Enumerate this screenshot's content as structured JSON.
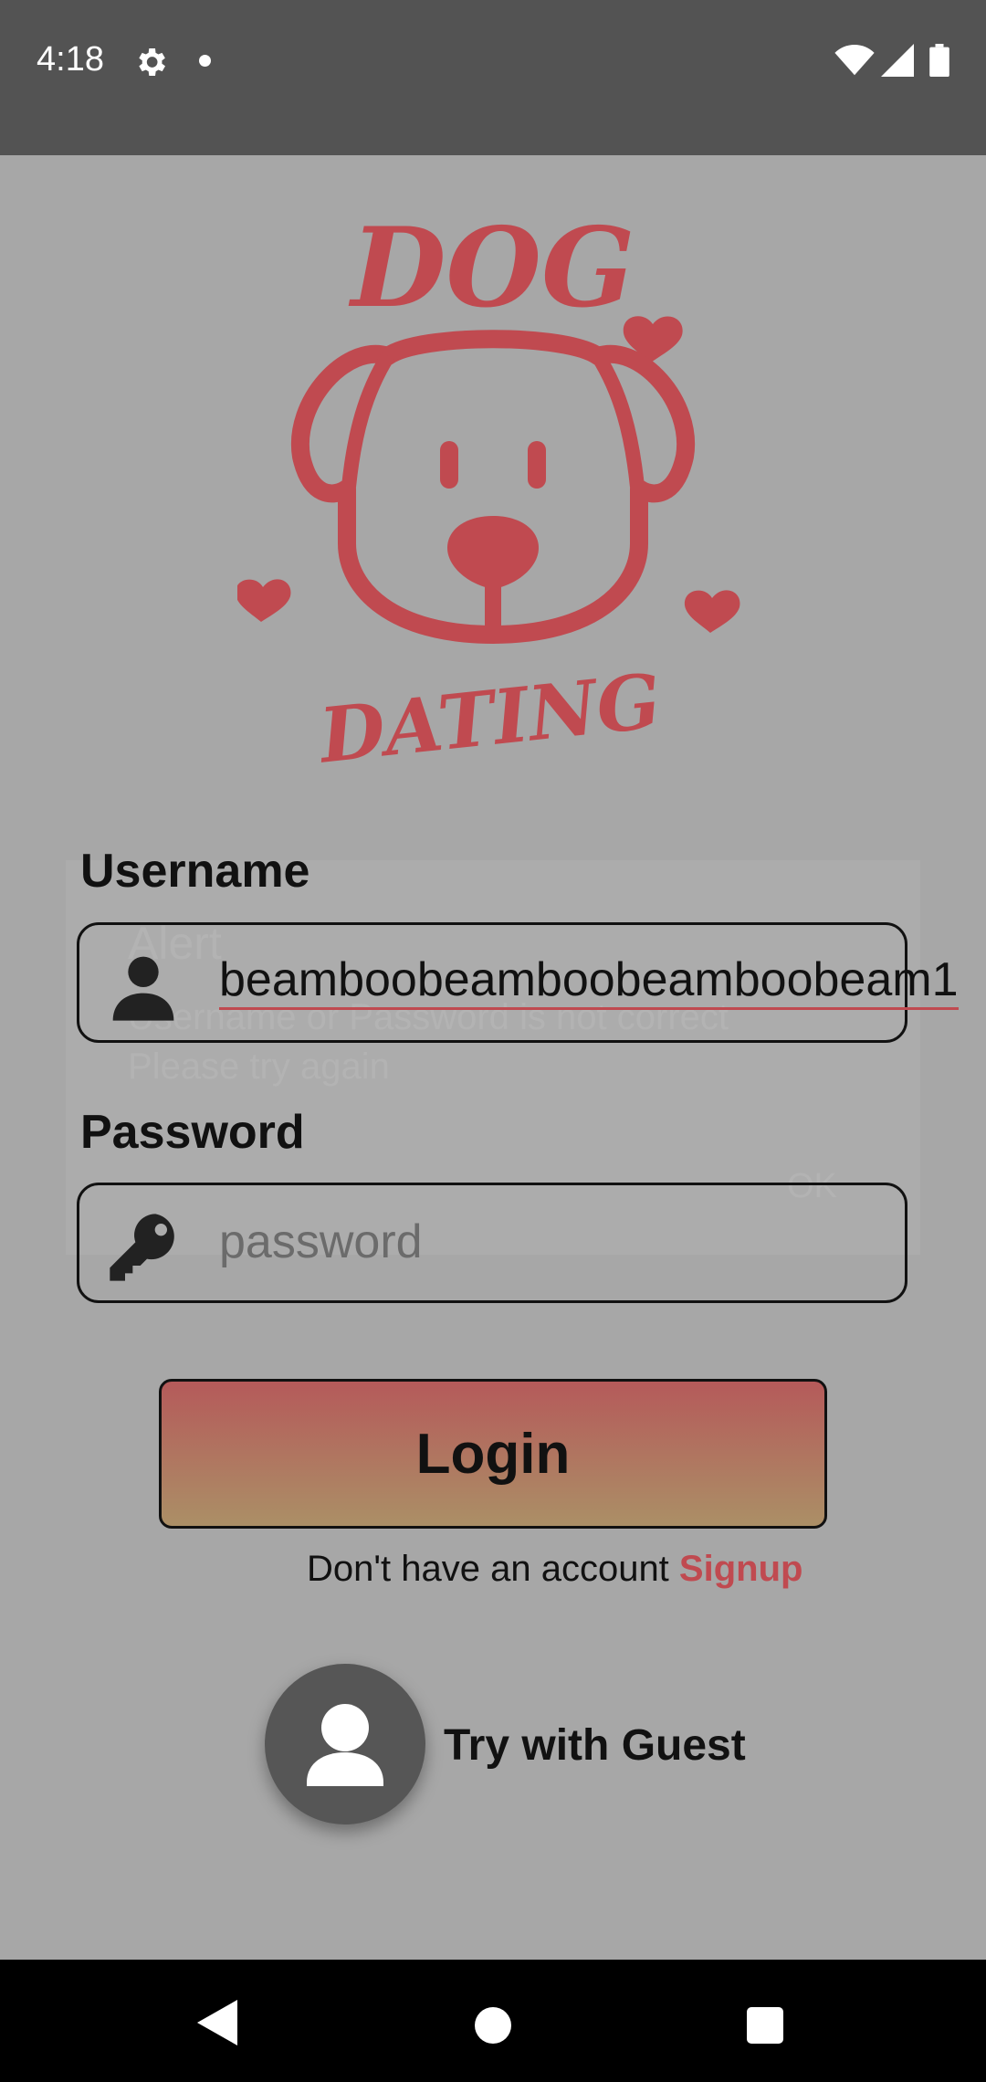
{
  "status_bar": {
    "time": "4:18",
    "icons": [
      "gear-icon",
      "notification-dot-icon",
      "wifi-icon",
      "signal-icon",
      "battery-icon"
    ]
  },
  "logo": {
    "top_text": "DOG",
    "bottom_text": "DATING",
    "color": "#c04a50"
  },
  "alert": {
    "title": "Alert",
    "message_line1": "Username or Password is not correct",
    "message_line2": "Please try again",
    "ok_label": "OK"
  },
  "form": {
    "username_label": "Username",
    "username_value": "beamboobeamboobeamboobeam1",
    "password_label": "Password",
    "password_placeholder": "password"
  },
  "login_button": {
    "label": "Login"
  },
  "signup": {
    "prompt": "Don't have an account",
    "link_label": "Signup"
  },
  "guest": {
    "label": "Try with Guest"
  },
  "colors": {
    "accent": "#c04a50",
    "scrim": "#a7a7a7"
  }
}
